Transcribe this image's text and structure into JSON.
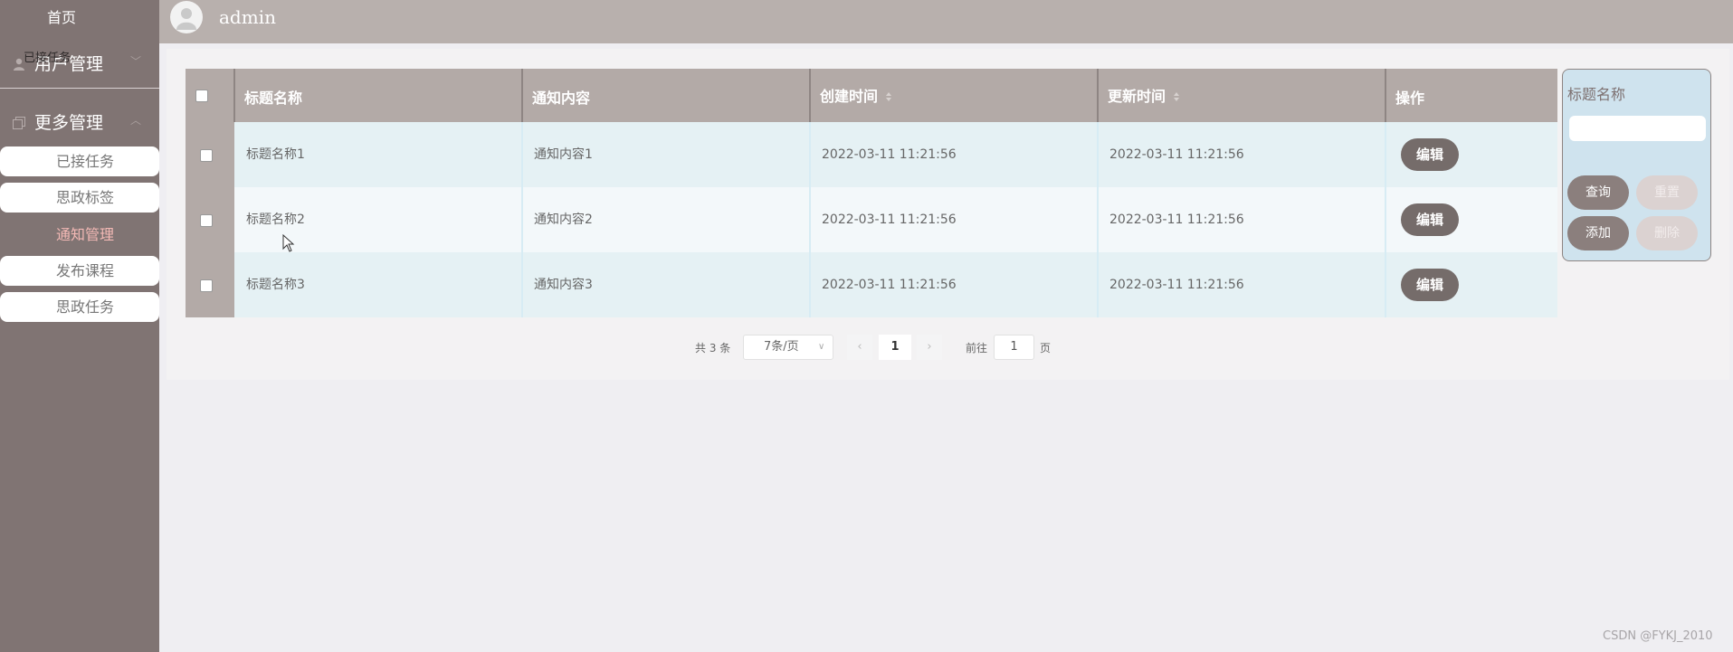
{
  "sidebar": {
    "home": "首页",
    "menus": [
      {
        "label": "用户管理",
        "overlay": "已接任务",
        "icon": "user-icon",
        "arrow": "chevron-down-icon"
      },
      {
        "label": "更多管理",
        "icon": "copy-icon",
        "arrow": "chevron-up-icon"
      }
    ],
    "items": [
      {
        "label": "已接任务"
      },
      {
        "label": "思政标签"
      },
      {
        "label": "通知管理"
      },
      {
        "label": "发布课程"
      },
      {
        "label": "思政任务"
      }
    ],
    "active_item": "通知管理",
    "active_color": "#f3b9b5"
  },
  "header": {
    "username": "admin",
    "avatar_icon": "avatar-icon"
  },
  "table": {
    "columns": [
      "标题名称",
      "通知内容",
      "创建时间",
      "更新时间",
      "操作"
    ],
    "sortable_columns": [
      "创建时间",
      "更新时间"
    ],
    "rows": [
      {
        "title": "标题名称1",
        "content": "通知内容1",
        "created": "2022-03-11 11:21:56",
        "updated": "2022-03-11 11:21:56",
        "action": "编辑"
      },
      {
        "title": "标题名称2",
        "content": "通知内容2",
        "created": "2022-03-11 11:21:56",
        "updated": "2022-03-11 11:21:56",
        "action": "编辑"
      },
      {
        "title": "标题名称3",
        "content": "通知内容3",
        "created": "2022-03-11 11:21:56",
        "updated": "2022-03-11 11:21:56",
        "action": "编辑"
      }
    ]
  },
  "pagination": {
    "total": "共 3 条",
    "page_size": "7条/页",
    "current_page": "1",
    "goto_label": "前往",
    "goto_value": "1",
    "page_suffix": "页"
  },
  "search": {
    "label": "标题名称",
    "input_value": "",
    "query": "查询",
    "reset": "重置",
    "add": "添加",
    "delete": "删除"
  },
  "colors": {
    "sidebar_bg": "#807473",
    "header_bg": "#b8b0ad",
    "table_header_bg": "#b3aaa7",
    "button_dark": "#756c6a",
    "search_box_bg": "#cfe3ee"
  },
  "watermark": "CSDN @FYKJ_2010"
}
